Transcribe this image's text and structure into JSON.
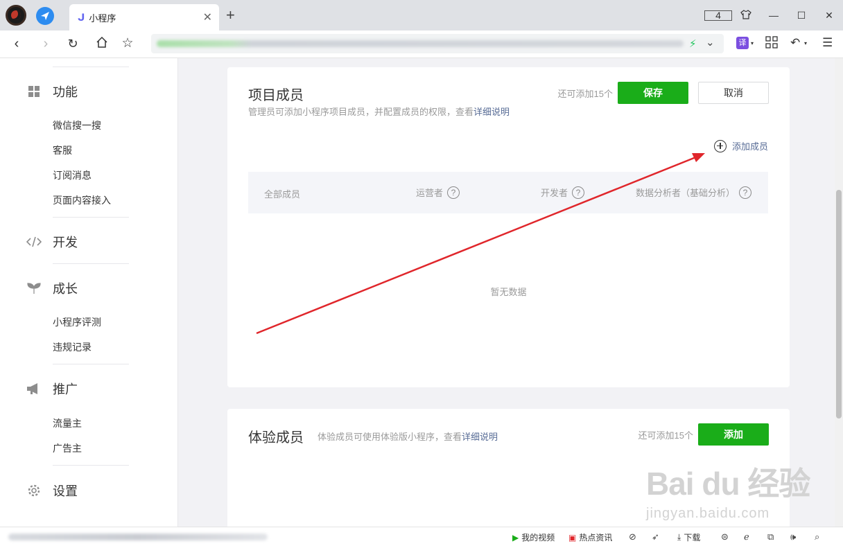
{
  "browser": {
    "tab_title": "小程序",
    "tab_count": "4",
    "new_tab": "+",
    "translate_label": "译"
  },
  "sidebar": {
    "sections": [
      {
        "title": "功能",
        "icon": "grid-icon",
        "items": [
          "微信搜一搜",
          "客服",
          "订阅消息",
          "页面内容接入"
        ]
      },
      {
        "title": "开发",
        "icon": "code-icon",
        "items": []
      },
      {
        "title": "成长",
        "icon": "sprout-icon",
        "items": [
          "小程序评测",
          "违规记录"
        ]
      },
      {
        "title": "推广",
        "icon": "megaphone-icon",
        "items": [
          "流量主",
          "广告主"
        ]
      },
      {
        "title": "设置",
        "icon": "gear-icon",
        "items": []
      }
    ]
  },
  "project_members": {
    "title": "项目成员",
    "description": "管理员可添加小程序项目成员，并配置成员的权限，查看",
    "description_link": "详细说明",
    "remaining": "还可添加15个",
    "save_label": "保存",
    "cancel_label": "取消",
    "add_member_label": "添加成员",
    "columns": [
      "全部成员",
      "运营者",
      "开发者",
      "数据分析者（基础分析）"
    ],
    "empty_text": "暂无数据"
  },
  "trial_members": {
    "title": "体验成员",
    "description": "体验成员可使用体验版小程序，查看",
    "description_link": "详细说明",
    "remaining": "还可添加15个",
    "add_label": "添加"
  },
  "statusbar": {
    "video_label": "我的视频",
    "news_label": "热点资讯",
    "download_label": "下载"
  },
  "watermark": {
    "brand": "Bai du 经验",
    "url": "jingyan.baidu.com"
  },
  "colors": {
    "primary_green": "#1aad19",
    "link_blue": "#576b95",
    "annotation_red": "#e0262b"
  }
}
